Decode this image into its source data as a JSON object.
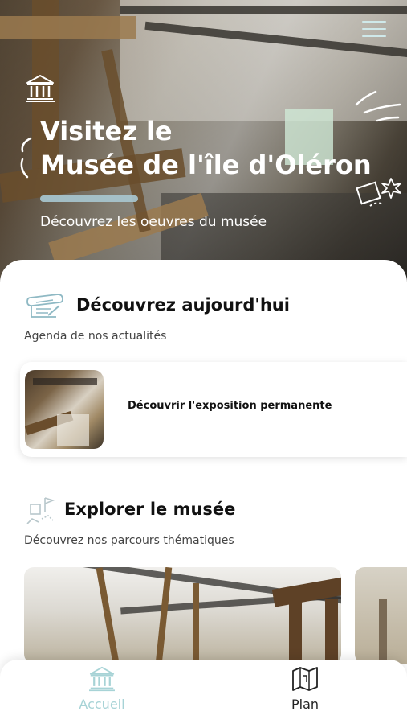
{
  "hero": {
    "title_line1": "Visitez le",
    "title_line2": "Musée de l'île d'Oléron",
    "subtitle": "Découvrez les oeuvres du musée"
  },
  "today": {
    "title": "Découvrez aujourd'hui",
    "subtitle": "Agenda de nos actualités",
    "card_label": "Découvrir l'exposition permanente"
  },
  "explore": {
    "title": "Explorer le musée",
    "subtitle": "Découvrez nos parcours thématiques"
  },
  "nav": {
    "items": [
      {
        "label": "Accueil",
        "icon": "museum-icon",
        "active": true
      },
      {
        "label": "Plan",
        "icon": "map-icon",
        "active": false
      }
    ]
  },
  "colors": {
    "accent": "#a7d3d6",
    "text": "#111111",
    "subtext": "#444444"
  }
}
